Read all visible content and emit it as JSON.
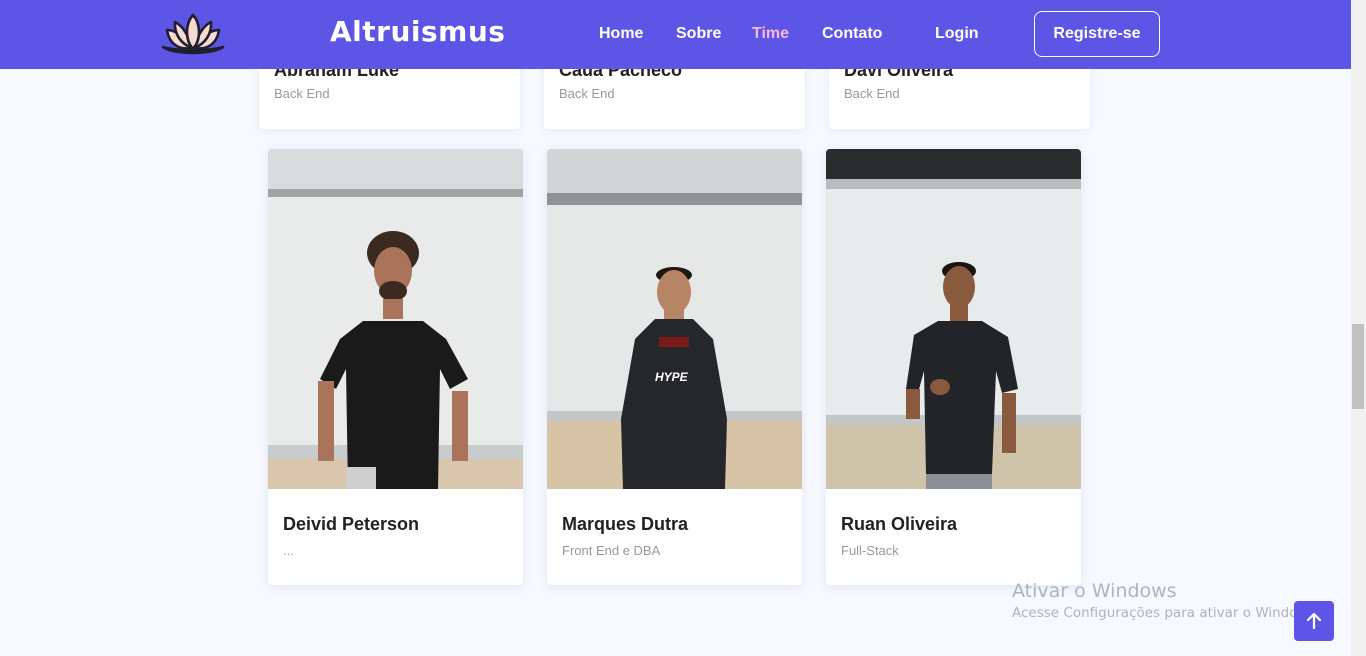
{
  "brand": {
    "name": "Altruismus",
    "logo": "lotus-logo-icon"
  },
  "nav": {
    "items": [
      {
        "label": "Home"
      },
      {
        "label": "Sobre"
      },
      {
        "label": "Time",
        "active": true
      },
      {
        "label": "Contato"
      }
    ],
    "login_label": "Login",
    "register_label": "Registre-se"
  },
  "colors": {
    "primary": "#5c55e6",
    "active_link": "#f6b9dd",
    "background": "#f6f9ff"
  },
  "top_cards": [
    {
      "name": "Abraham Luke",
      "role": "Back End"
    },
    {
      "name": "Cauã Pacheco",
      "role": "Back End"
    },
    {
      "name": "Davi Oliveira",
      "role": "Back End"
    }
  ],
  "members": [
    {
      "name": "Deivid Peterson",
      "role": "...",
      "photo": "member-photo"
    },
    {
      "name": "Marques Dutra",
      "role": "Front End e DBA",
      "photo": "member-photo",
      "shirt_text": "HYPE"
    },
    {
      "name": "Ruan Oliveira",
      "role": "Full-Stack",
      "photo": "member-photo"
    }
  ],
  "watermark": {
    "title": "Ativar o Windows",
    "subtitle": "Acesse Configurações para ativar o Windows."
  },
  "back_to_top": {
    "icon": "arrow-up-icon"
  }
}
